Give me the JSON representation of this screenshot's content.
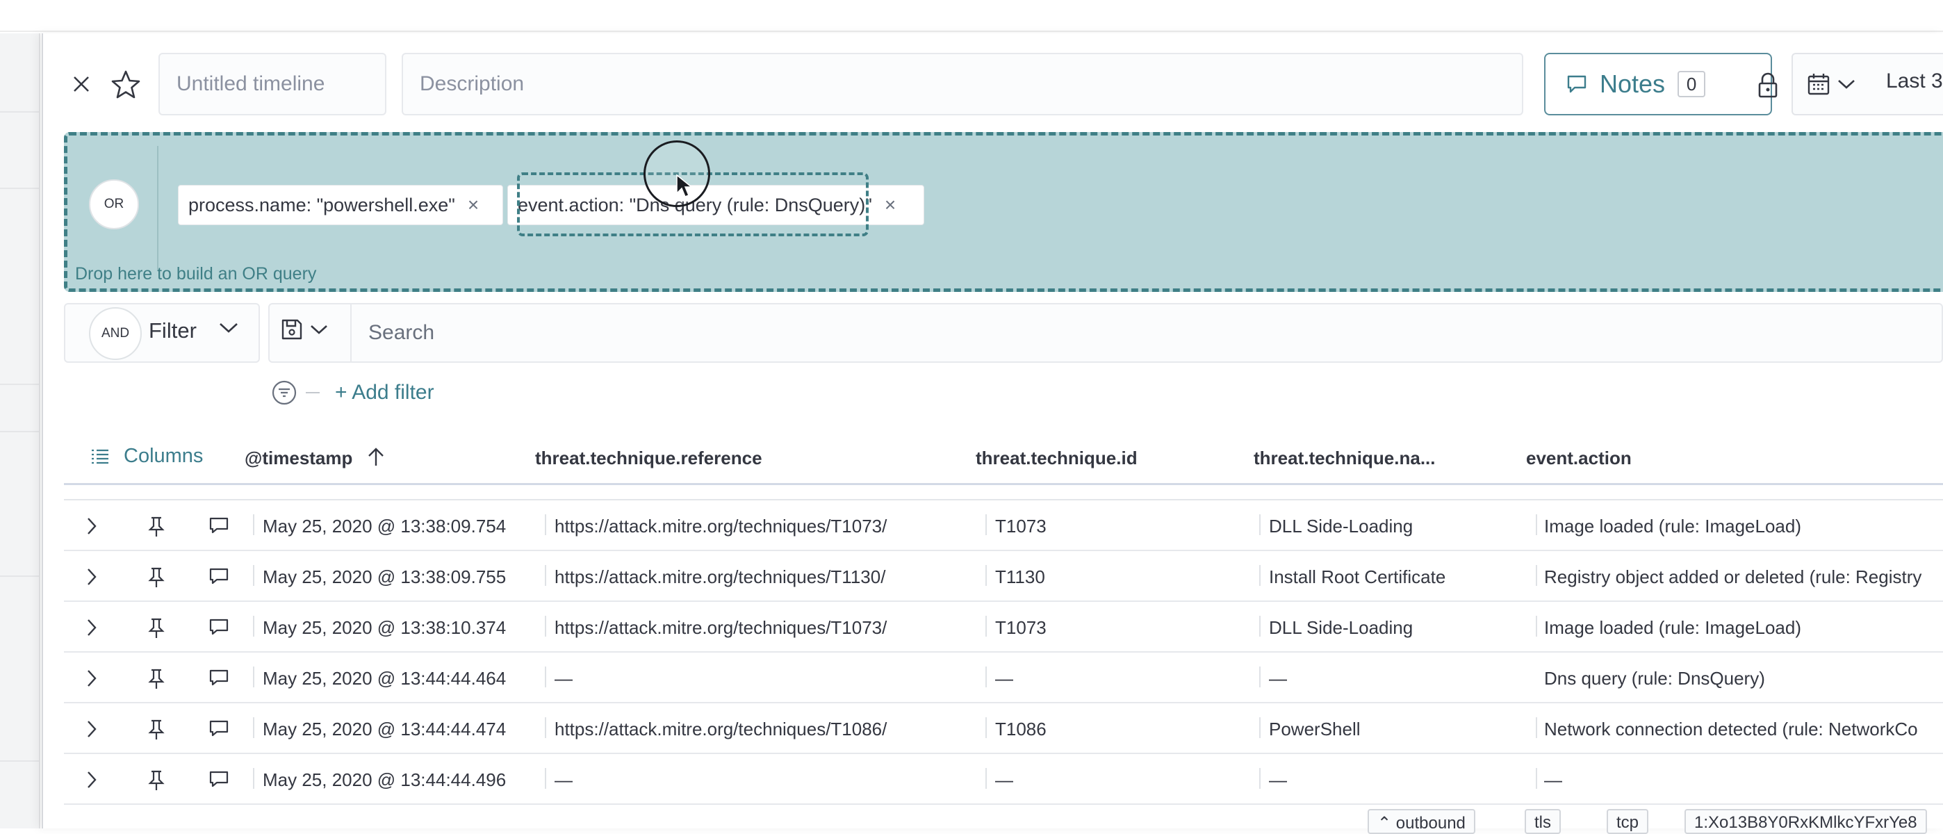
{
  "timeline": {
    "title_placeholder": "Untitled timeline",
    "description_placeholder": "Description",
    "notes_label": "Notes",
    "notes_count": "0",
    "date_label": "Last 3"
  },
  "dropzone": {
    "or_label": "OR",
    "hint": "Drop here to build an OR query",
    "pills": [
      {
        "text": "process.name: \"powershell.exe\""
      },
      {
        "text": "event.action: \"Dns query (rule: DnsQuery)\""
      }
    ]
  },
  "filterbar": {
    "and_label": "AND",
    "filter_label": "Filter",
    "search_placeholder": "Search",
    "add_filter_label": "+ Add filter"
  },
  "table": {
    "columns_label": "Columns",
    "headers": [
      "@timestamp",
      "threat.technique.reference",
      "threat.technique.id",
      "threat.technique.na...",
      "event.action"
    ],
    "rows": [
      {
        "timestamp": "May 25, 2020 @ 13:38:09.754",
        "reference": "https://attack.mitre.org/techniques/T1073/",
        "id": "T1073",
        "name": "DLL Side-Loading",
        "action": "Image loaded (rule: ImageLoad)"
      },
      {
        "timestamp": "May 25, 2020 @ 13:38:09.755",
        "reference": "https://attack.mitre.org/techniques/T1130/",
        "id": "T1130",
        "name": "Install Root Certificate",
        "action": "Registry object added or deleted (rule: Registry"
      },
      {
        "timestamp": "May 25, 2020 @ 13:38:10.374",
        "reference": "https://attack.mitre.org/techniques/T1073/",
        "id": "T1073",
        "name": "DLL Side-Loading",
        "action": "Image loaded (rule: ImageLoad)"
      },
      {
        "timestamp": "May 25, 2020 @ 13:44:44.464",
        "reference": "—",
        "id": "—",
        "name": "—",
        "action": "Dns query (rule: DnsQuery)"
      },
      {
        "timestamp": "May 25, 2020 @ 13:44:44.474",
        "reference": "https://attack.mitre.org/techniques/T1086/",
        "id": "T1086",
        "name": "PowerShell",
        "action": "Network connection detected (rule: NetworkCo"
      },
      {
        "timestamp": "May 25, 2020 @ 13:44:44.496",
        "reference": "—",
        "id": "—",
        "name": "—",
        "action": "—"
      }
    ],
    "bottom_badges": [
      "outbound",
      "tls",
      "tcp",
      "1:Xo13B8Y0RxKMlkcYFxrYe8"
    ]
  },
  "colors": {
    "accent": "#3c7d8c",
    "dropzone_bg": "#b7d5d8",
    "dropzone_border": "#3f7f86"
  },
  "icons": [
    "close-icon",
    "star-icon",
    "notes-icon",
    "lock-icon",
    "calendar-icon",
    "chevron-down-icon",
    "save-icon",
    "filter-icon",
    "columns-icon",
    "sort-up-icon",
    "expand-icon",
    "pin-icon",
    "comment-icon",
    "cursor-icon"
  ]
}
